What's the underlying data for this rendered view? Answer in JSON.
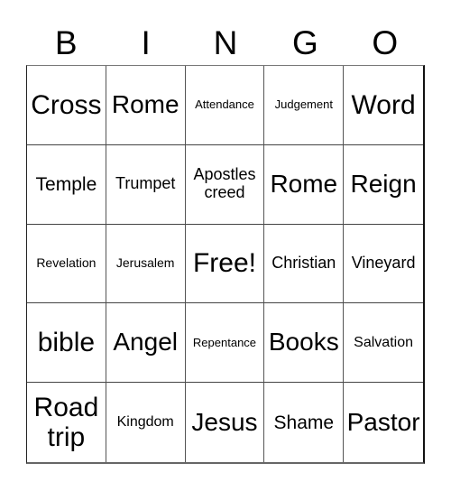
{
  "card": {
    "header": [
      "B",
      "I",
      "N",
      "G",
      "O"
    ],
    "cells": [
      {
        "text": "Cross",
        "size": "xl"
      },
      {
        "text": "Rome",
        "size": "l"
      },
      {
        "text": "Attendance",
        "size": "xxs"
      },
      {
        "text": "Judgement",
        "size": "xxs"
      },
      {
        "text": "Word",
        "size": "xl"
      },
      {
        "text": "Temple",
        "size": "m"
      },
      {
        "text": "Trumpet",
        "size": "sm"
      },
      {
        "text": "Apostles creed",
        "size": "sm"
      },
      {
        "text": "Rome",
        "size": "l"
      },
      {
        "text": "Reign",
        "size": "l"
      },
      {
        "text": "Revelation",
        "size": "xs"
      },
      {
        "text": "Jerusalem",
        "size": "xs"
      },
      {
        "text": "Free!",
        "size": "xl"
      },
      {
        "text": "Christian",
        "size": "sm"
      },
      {
        "text": "Vineyard",
        "size": "sm"
      },
      {
        "text": "bible",
        "size": "xl"
      },
      {
        "text": "Angel",
        "size": "l"
      },
      {
        "text": "Repentance",
        "size": "xxs"
      },
      {
        "text": "Books",
        "size": "l"
      },
      {
        "text": "Salvation",
        "size": "s"
      },
      {
        "text": "Road trip",
        "size": "xl"
      },
      {
        "text": "Kingdom",
        "size": "s"
      },
      {
        "text": "Jesus",
        "size": "l"
      },
      {
        "text": "Shame",
        "size": "m"
      },
      {
        "text": "Pastor",
        "size": "l"
      }
    ]
  }
}
